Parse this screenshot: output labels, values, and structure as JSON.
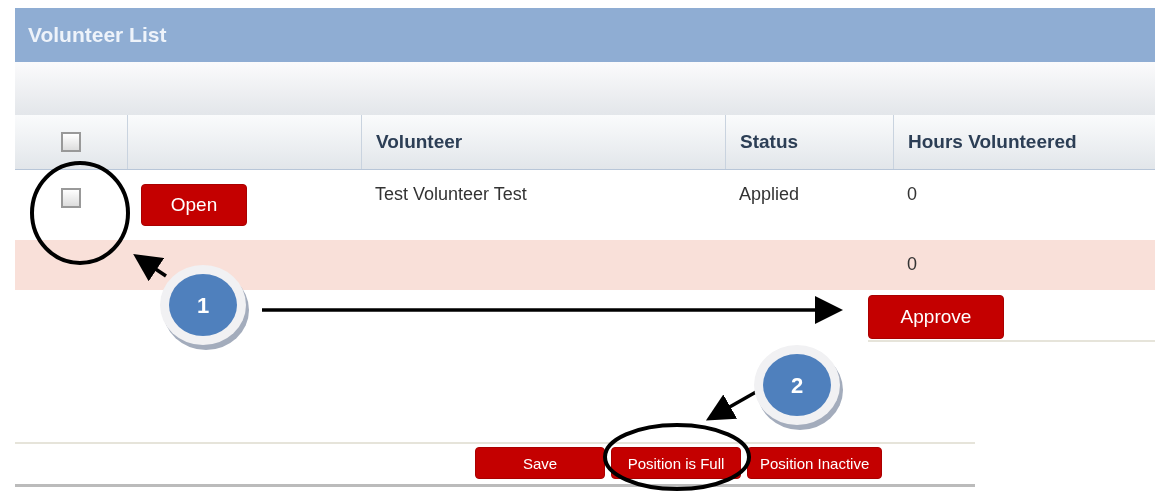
{
  "panel": {
    "title": "Volunteer List"
  },
  "table": {
    "select_all": {
      "checked": false
    },
    "columns": [
      {
        "label": "Volunteer"
      },
      {
        "label": "Status"
      },
      {
        "label": "Hours Volunteered"
      }
    ],
    "rows": [
      {
        "checked": false,
        "action": "Open",
        "volunteer": "Test Volunteer Test",
        "status": "Applied",
        "hours": "0"
      }
    ],
    "total": {
      "hours": "0"
    },
    "approve_button": "Approve"
  },
  "footer_buttons": [
    {
      "label": "Save"
    },
    {
      "label": "Position is Full"
    },
    {
      "label": "Position Inactive"
    }
  ],
  "callouts": [
    {
      "number": "1"
    },
    {
      "number": "2"
    }
  ]
}
